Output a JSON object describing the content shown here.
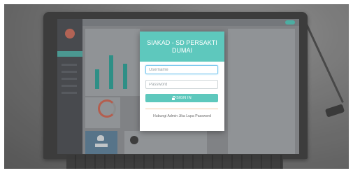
{
  "modal": {
    "title": "SIAKAD - SD PERSAKTI DUMAI",
    "username_placeholder": "Username",
    "password_placeholder": "Password",
    "signin_label": "SIGN IN",
    "help_text": "Hubungi Admin Jika Lupa Password"
  },
  "colors": {
    "accent": "#5ec8bd",
    "input_focus": "#7fc9ef",
    "divider": "#f0c9a8"
  },
  "icons": {
    "signin": "lock-icon"
  }
}
